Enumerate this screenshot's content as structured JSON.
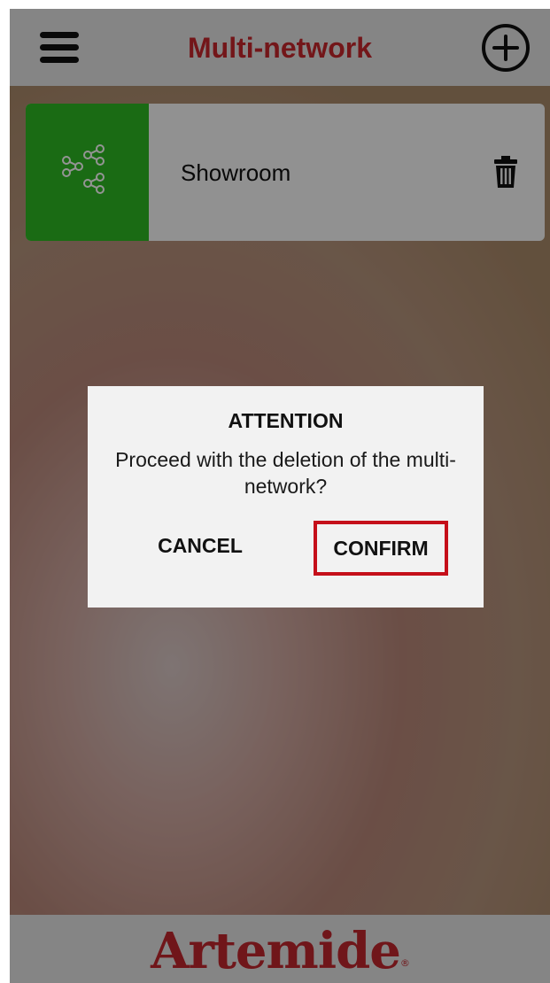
{
  "header": {
    "title": "Multi-network",
    "menu_icon": "hamburger-menu-icon",
    "add_icon": "plus-circle-icon"
  },
  "networks": [
    {
      "name": "Showroom",
      "icon": "multi-network-share-icon",
      "icon_bg_color": "#2db924",
      "delete_icon": "trash-icon"
    }
  ],
  "dialog": {
    "title": "ATTENTION",
    "message": "Proceed with the deletion of the multi-network?",
    "cancel_label": "CANCEL",
    "confirm_label": "CONFIRM",
    "highlight_color": "#c50f1a"
  },
  "footer": {
    "brand": "Artemide",
    "registered_mark": "®"
  },
  "colors": {
    "accent": "#c6262c",
    "bar_background": "#e6e6e6"
  }
}
